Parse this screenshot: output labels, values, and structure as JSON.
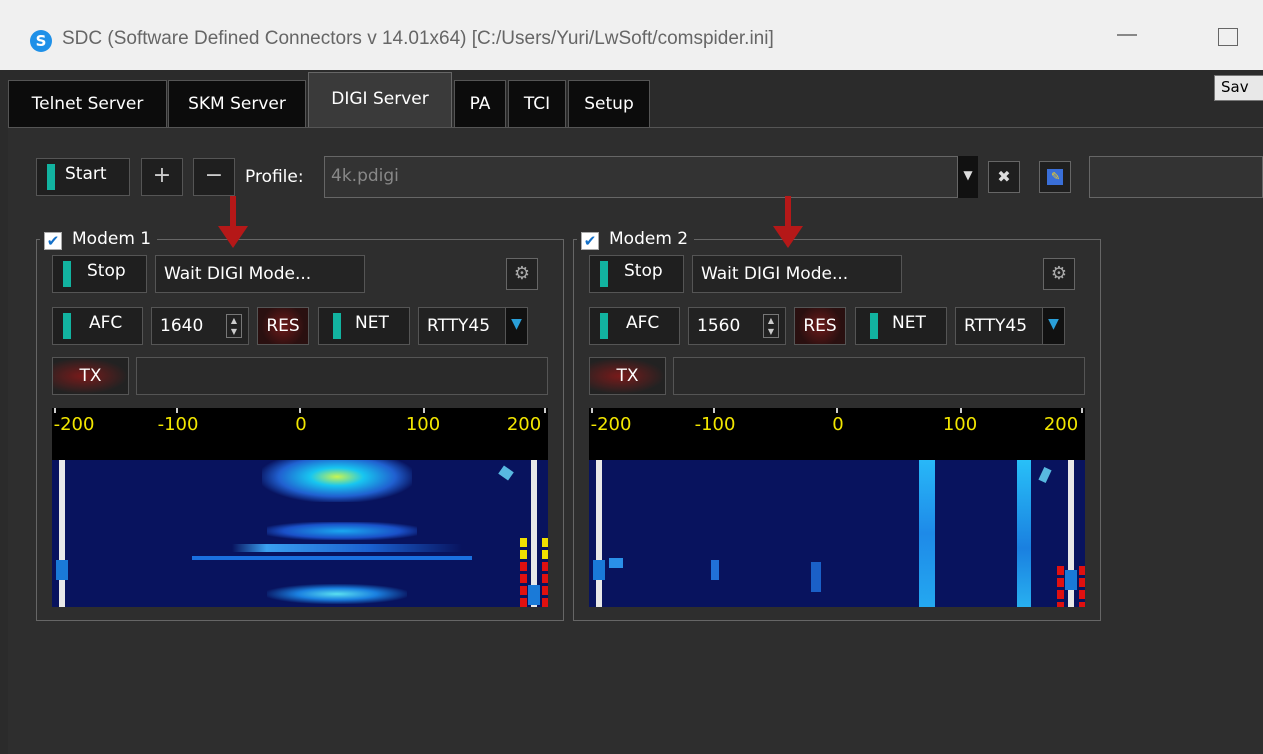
{
  "window": {
    "title": "SDC (Software Defined Connectors v 14.01x64) [C:/Users/Yuri/LwSoft/comspider.ini]",
    "logo_letter": "S"
  },
  "tabs": [
    {
      "label": "Telnet Server",
      "active": false
    },
    {
      "label": "SKM Server",
      "active": false
    },
    {
      "label": "DIGI Server",
      "active": true
    },
    {
      "label": "PA",
      "active": false
    },
    {
      "label": "TCI",
      "active": false
    },
    {
      "label": "Setup",
      "active": false
    }
  ],
  "save_label": "Sav",
  "toolbar": {
    "start_label": "Start",
    "add_label": "+",
    "remove_label": "−",
    "profile_label": "Profile:",
    "profile_value": "4k.pdigi",
    "delete_icon": "x-icon",
    "edit_icon": "edit-icon"
  },
  "modems": [
    {
      "title": "Modem 1",
      "enabled": true,
      "stop_label": "Stop",
      "status": "Wait DIGI Mode...",
      "afc_label": "AFC",
      "frequency": "1640",
      "res_label": "RES",
      "net_label": "NET",
      "mode": "RTTY45",
      "tx_label": "TX",
      "tx_text": "",
      "scale_ticks": [
        "-200",
        "-100",
        "0",
        "100",
        "200"
      ]
    },
    {
      "title": "Modem 2",
      "enabled": true,
      "stop_label": "Stop",
      "status": "Wait DIGI Mode...",
      "afc_label": "AFC",
      "frequency": "1560",
      "res_label": "RES",
      "net_label": "NET",
      "mode": "RTTY45",
      "tx_label": "TX",
      "tx_text": "",
      "scale_ticks": [
        "-200",
        "-100",
        "0",
        "100",
        "200"
      ]
    }
  ],
  "colors": {
    "accent_green": "#12b3a0",
    "scale_text": "#f2e600",
    "arrow": "#b51818",
    "waterfall_bg": "#08135e"
  }
}
